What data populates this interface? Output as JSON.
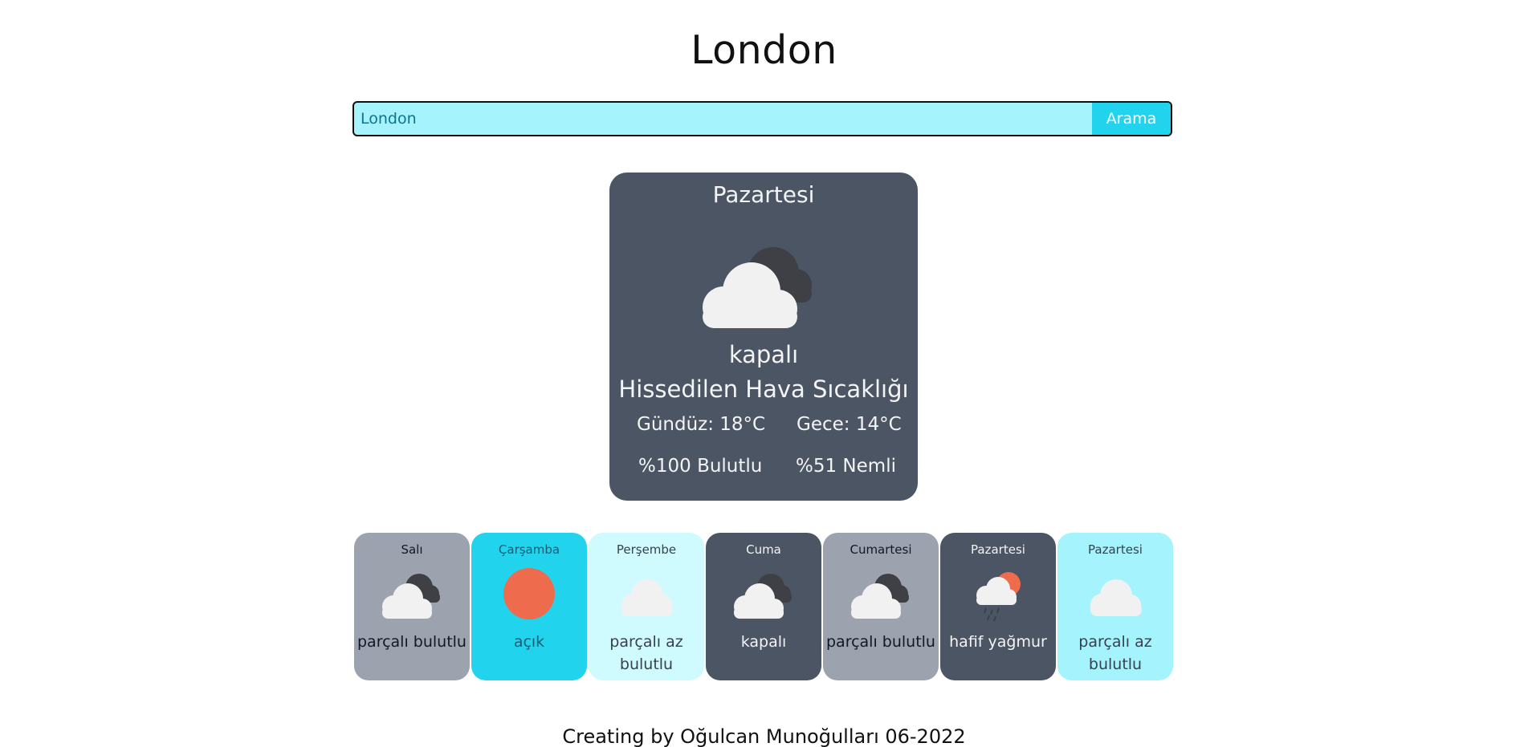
{
  "header": {
    "city": "London"
  },
  "search": {
    "value": "London",
    "button_label": "Arama"
  },
  "current": {
    "day": "Pazartesi",
    "icon": "cloudy-overcast-icon",
    "description": "kapalı",
    "feels_like_label": "Hissedilen Hava Sıcaklığı",
    "day_temp": "Gündüz: 18°C",
    "night_temp": "Gece: 14°C",
    "cloudiness": "%100 Bulutlu",
    "humidity": "%51 Nemli"
  },
  "forecast": [
    {
      "day": "Salı",
      "description": "parçalı bulutlu",
      "icon": "broken-clouds-icon",
      "theme": "gray"
    },
    {
      "day": "Çarşamba",
      "description": "açık",
      "icon": "sun-icon",
      "theme": "cyan"
    },
    {
      "day": "Perşembe",
      "description": "parçalı az bulutlu",
      "icon": "few-clouds-icon",
      "theme": "light"
    },
    {
      "day": "Cuma",
      "description": "kapalı",
      "icon": "overcast-clouds-icon",
      "theme": "dark"
    },
    {
      "day": "Cumartesi",
      "description": "parçalı bulutlu",
      "icon": "broken-clouds-icon",
      "theme": "gray"
    },
    {
      "day": "Pazartesi",
      "description": "hafif yağmur",
      "icon": "light-rain-icon",
      "theme": "dark"
    },
    {
      "day": "Pazartesi",
      "description": "parçalı az bulutlu",
      "icon": "few-clouds-icon",
      "theme": "aqua"
    }
  ],
  "colors": {
    "card_dark": "#4b5563",
    "card_gray": "#9ca3af",
    "accent_cyan": "#22d3ee",
    "input_bg": "#a5f3fc",
    "sun": "#ee6c4d"
  },
  "footer": {
    "text": "Creating by Oğulcan Munoğulları 06-2022"
  }
}
